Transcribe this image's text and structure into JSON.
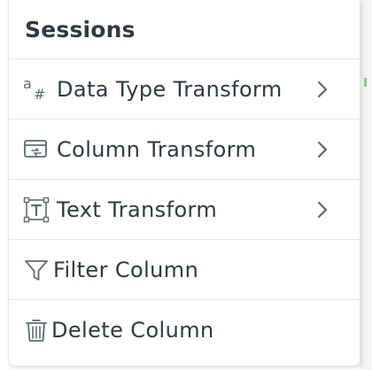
{
  "menu": {
    "title": "Sessions",
    "items": [
      {
        "label": "Data Type Transform",
        "icon": "data-type-icon",
        "has_submenu": true
      },
      {
        "label": "Column Transform",
        "icon": "column-transform-icon",
        "has_submenu": true
      },
      {
        "label": "Text Transform",
        "icon": "text-transform-icon",
        "has_submenu": true
      },
      {
        "label": "Filter Column",
        "icon": "filter-icon",
        "has_submenu": false
      },
      {
        "label": "Delete Column",
        "icon": "trash-icon",
        "has_submenu": false
      }
    ]
  },
  "colors": {
    "text": "#2f3a40",
    "icon": "#5f6a70",
    "divider": "#e4e6e8",
    "accent_tick": "#8fc98a"
  }
}
